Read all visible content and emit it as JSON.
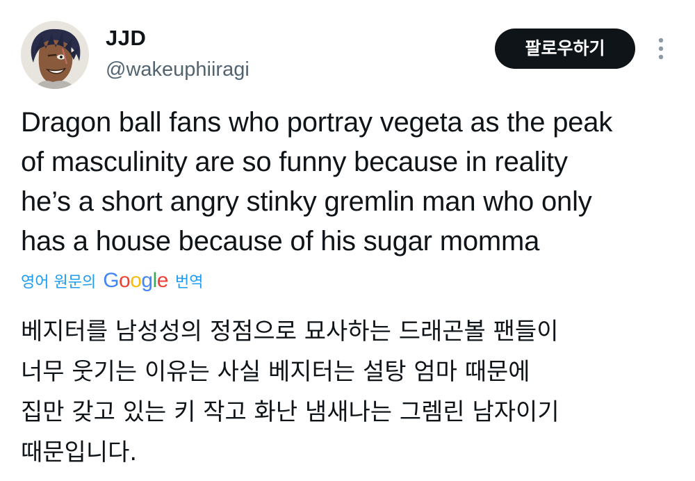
{
  "author": {
    "display_name": "JJD",
    "handle": "@wakeuphiiragi",
    "avatar_icon": "user-avatar"
  },
  "actions": {
    "follow_label": "팔로우하기",
    "more_icon": "more-vertical-icon"
  },
  "tweet": {
    "lines": [
      "Dragon ball fans who portray vegeta as the peak",
      "of masculinity are so funny because in reality",
      "he’s a short angry stinky gremlin man who only",
      "has a house because of his sugar momma"
    ]
  },
  "translation": {
    "prefix": "영어 원문의",
    "provider_letters": [
      "G",
      "o",
      "o",
      "g",
      "l",
      "e"
    ],
    "provider_colors": [
      "#4285f4",
      "#ea4335",
      "#fbbc05",
      "#4285f4",
      "#34a853",
      "#ea4335"
    ],
    "suffix": "번역",
    "lines": [
      "베지터를 남성성의 정점으로 묘사하는 드래곤볼 팬들이",
      "너무 웃기는 이유는 사실 베지터는 설탕 엄마 때문에",
      "집만 갖고 있는 키 작고 화난 냄새나는 그렘린 남자이기",
      "때문입니다."
    ]
  },
  "colors": {
    "text": "#0f1419",
    "secondary": "#536471",
    "link": "#1d9bf0",
    "button_bg": "#0f1419"
  }
}
